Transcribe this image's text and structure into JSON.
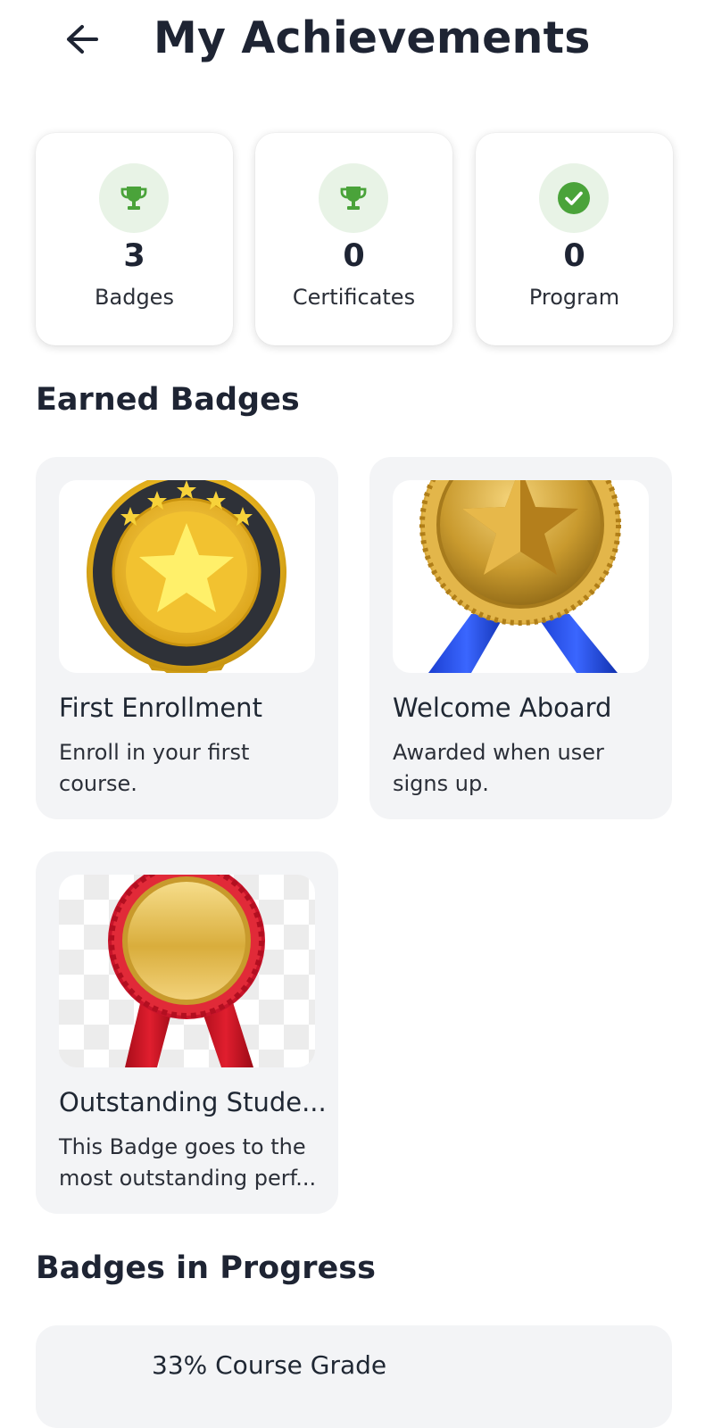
{
  "header": {
    "title": "My Achievements",
    "back_icon": "arrow-left-icon"
  },
  "stats": [
    {
      "icon": "trophy-icon",
      "count": "3",
      "label": "Badges"
    },
    {
      "icon": "trophy-icon",
      "count": "0",
      "label": "Certificates"
    },
    {
      "icon": "check-circle-icon",
      "count": "0",
      "label": "Program"
    }
  ],
  "earned_section": {
    "title": "Earned Badges",
    "badges": [
      {
        "name": "First Enrollment",
        "description": "Enroll in your first course.",
        "image": "gold-star-medal"
      },
      {
        "name": "Welcome Aboard",
        "description": "Awarded when user signs up.",
        "image": "gold-star-blue-ribbon"
      },
      {
        "name": "Outstanding Stude...",
        "description": "This Badge goes to the most outstanding perf...",
        "image": "gold-medal-red-ribbon"
      }
    ]
  },
  "progress_section": {
    "title": "Badges in Progress",
    "items": [
      {
        "label": "33% Course Grade"
      }
    ]
  },
  "colors": {
    "accent_green": "#4aa33a",
    "icon_bg": "#e8f3e6",
    "card_bg": "#f3f4f6",
    "title": "#1e2433"
  }
}
